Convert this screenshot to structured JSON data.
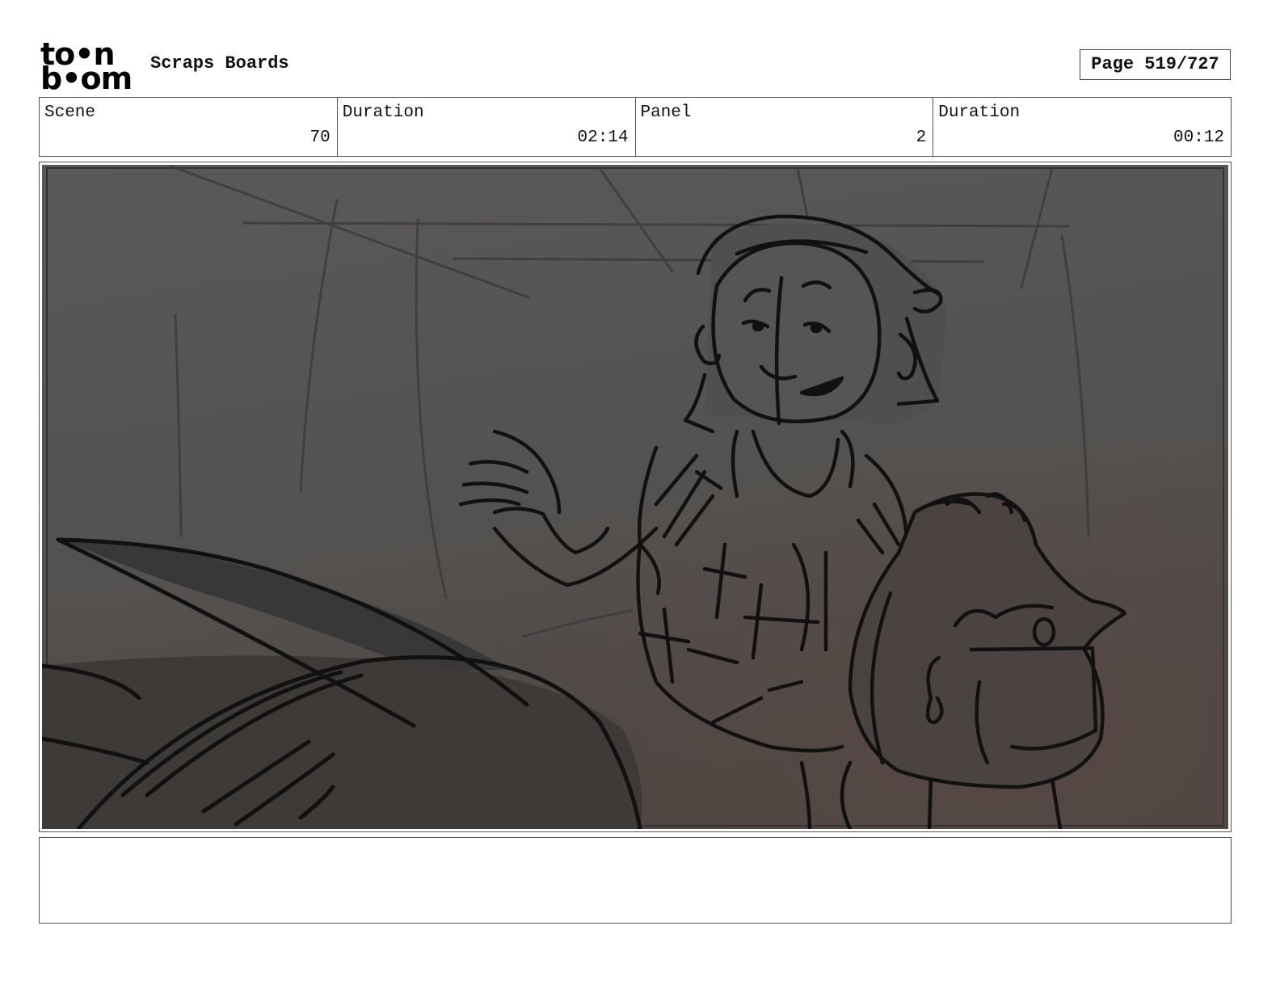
{
  "header": {
    "logo_line1": "to•n",
    "logo_line2": "b•om",
    "project_title": "Scraps Boards",
    "page_indicator": "Page 519/727"
  },
  "info": {
    "scene_label": "Scene",
    "scene_value": "70",
    "scene_duration_label": "Duration",
    "scene_duration_value": "02:14",
    "panel_label": "Panel",
    "panel_value": "2",
    "panel_duration_label": "Duration",
    "panel_duration_value": "00:12"
  },
  "panel": {
    "icon": "storyboard-sketch"
  },
  "notes": {
    "text": ""
  },
  "colors": {
    "panel_bg_top": "#575757",
    "panel_bg_bottom": "#4a433f",
    "sketch_line": "#111111"
  }
}
